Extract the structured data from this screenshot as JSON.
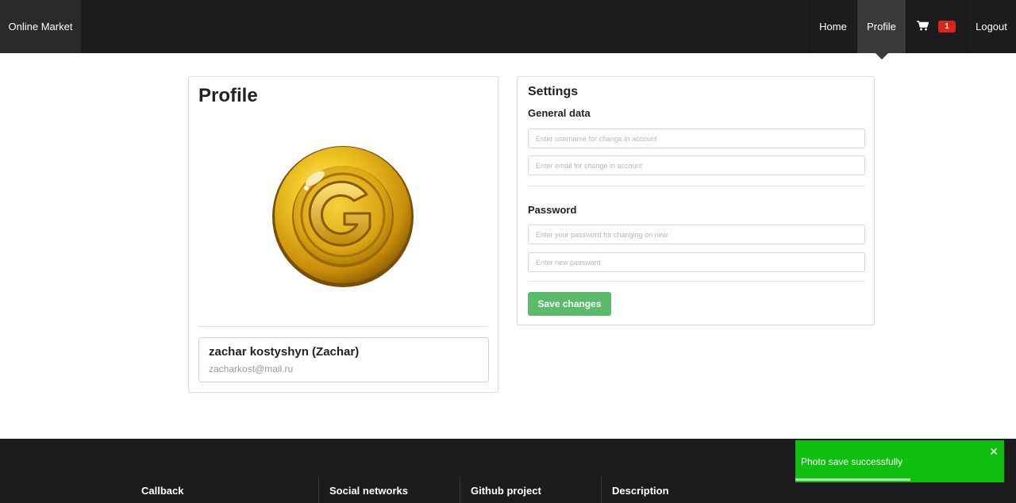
{
  "navbar": {
    "brand": "Online Market",
    "home": "Home",
    "profile": "Profile",
    "cart_icon": "cart-icon",
    "cart_count": "1",
    "logout": "Logout"
  },
  "profile": {
    "title": "Profile",
    "avatar_icon": "gold-coin-g-avatar",
    "user_name": "zachar kostyshyn (Zachar)",
    "user_email": "zacharkost@mail.ru"
  },
  "settings": {
    "title": "Settings",
    "general_label": "General data",
    "username_placeholder": "Enter username for change in account",
    "email_placeholder": "Enter email for change in account",
    "password_label": "Password",
    "current_password_placeholder": "Enter your password for changing on new",
    "new_password_placeholder": "Enter new password",
    "save_label": "Save changes"
  },
  "footer": {
    "columns": [
      "Callback",
      "Social networks",
      "Github project",
      "Description"
    ]
  },
  "toast": {
    "message": "Photo save successfully",
    "close_icon": "close-icon",
    "progress_fraction": 0.55
  },
  "colors": {
    "navbar_bg": "#1c1c1e",
    "save_button": "#5cba6b",
    "toast_bg": "#10c010",
    "badge": "#d9261c"
  }
}
